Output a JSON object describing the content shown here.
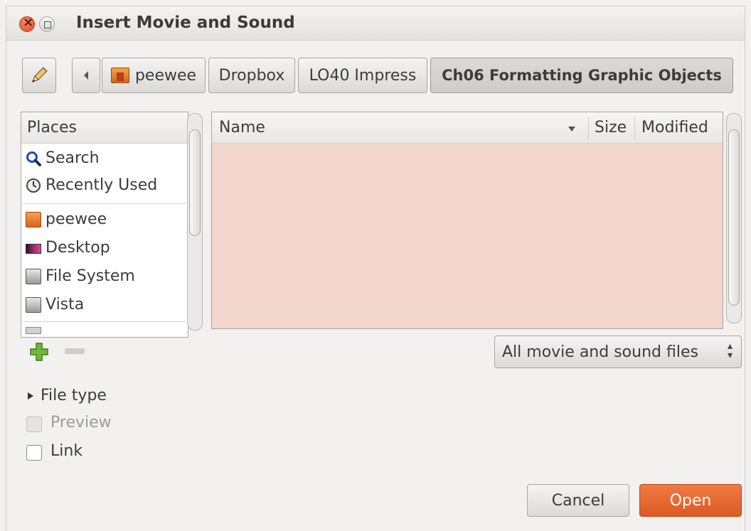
{
  "window": {
    "title": "Insert Movie and Sound"
  },
  "toolbar": {
    "edit_icon": "pencil-icon",
    "back_icon": "left-arrow-icon",
    "breadcrumbs": [
      "peewee",
      "Dropbox",
      "LO40 Impress",
      "Ch06 Formatting Graphic Objects"
    ]
  },
  "places": {
    "header": "Places",
    "items": [
      {
        "label": "Search",
        "icon": "search-icon"
      },
      {
        "label": "Recently Used",
        "icon": "clock-icon"
      },
      {
        "label": "peewee",
        "icon": "home-folder-icon"
      },
      {
        "label": "Desktop",
        "icon": "desktop-icon"
      },
      {
        "label": "File System",
        "icon": "drive-icon"
      },
      {
        "label": "Vista",
        "icon": "drive-icon"
      }
    ],
    "add_icon": "plus-icon",
    "remove_icon": "minus-icon"
  },
  "files": {
    "columns": [
      "Name",
      "Size",
      "Modified"
    ],
    "rows": []
  },
  "filter": {
    "selected": "All movie and sound files"
  },
  "options": {
    "file_type_label": "File type",
    "preview_label": "Preview",
    "preview_checked": false,
    "link_label": "Link",
    "link_checked": false
  },
  "buttons": {
    "cancel": "Cancel",
    "open": "Open"
  },
  "colors": {
    "accent": "#e3612a",
    "files_bg": "#f2d5cb"
  }
}
